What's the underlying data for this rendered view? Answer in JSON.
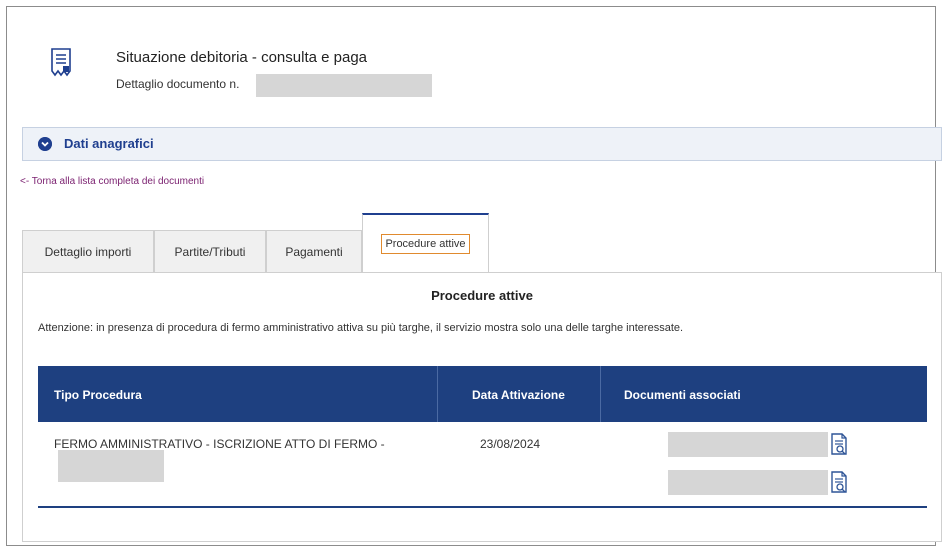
{
  "header": {
    "title": "Situazione debitoria - consulta e paga",
    "subtitle_prefix": "Dettaglio documento n."
  },
  "dati_anagrafici": {
    "label": "Dati anagrafici"
  },
  "back_link": "<- Torna alla lista completa dei documenti",
  "tabs": [
    {
      "label": "Dettaglio importi"
    },
    {
      "label": "Partite/Tributi"
    },
    {
      "label": "Pagamenti"
    },
    {
      "label": "Procedure attive"
    }
  ],
  "section": {
    "title": "Procedure attive",
    "warning": "Attenzione: in presenza di procedura di fermo amministrativo attiva su più targhe, il servizio mostra solo una delle targhe interessate."
  },
  "table": {
    "headers": [
      "Tipo Procedura",
      "Data Attivazione",
      "Documenti associati"
    ],
    "rows": [
      {
        "tipo": "FERMO AMMINISTRATIVO - ISCRIZIONE ATTO DI FERMO -",
        "data": "23/08/2024"
      }
    ]
  },
  "colors": {
    "primary": "#1e4080",
    "accent_link": "#7a1f6f",
    "active_tab_outline": "#e08a2e"
  }
}
